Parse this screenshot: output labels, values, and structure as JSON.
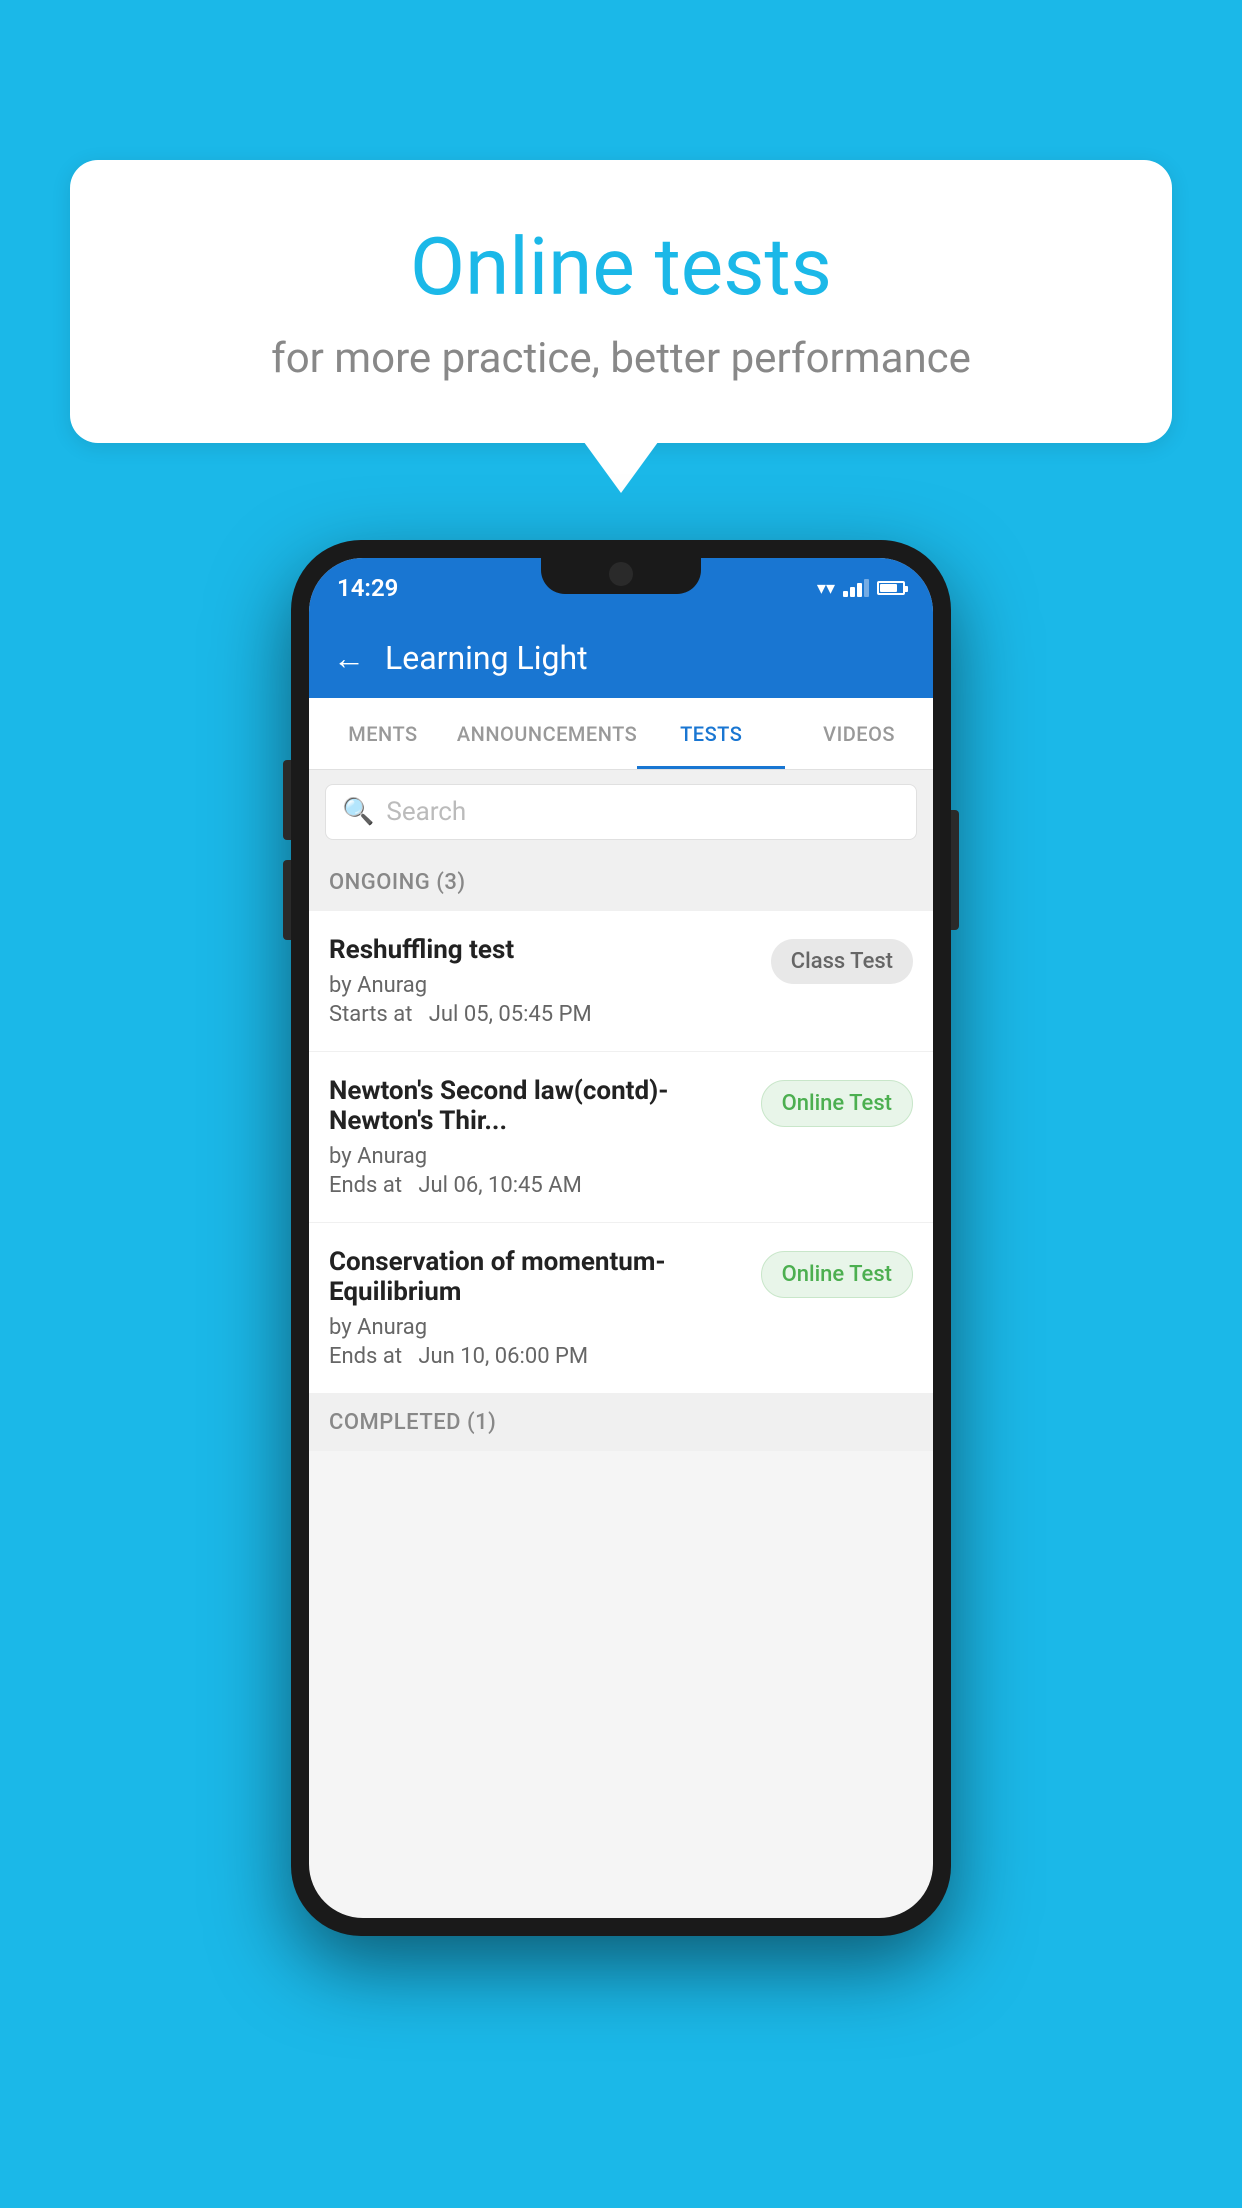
{
  "background": {
    "color": "#1BB8E8"
  },
  "speech_bubble": {
    "title": "Online tests",
    "subtitle": "for more practice, better performance"
  },
  "phone": {
    "status_bar": {
      "time": "14:29"
    },
    "app_header": {
      "title": "Learning Light",
      "back_label": "←"
    },
    "tabs": [
      {
        "label": "MENTS",
        "active": false
      },
      {
        "label": "ANNOUNCEMENTS",
        "active": false
      },
      {
        "label": "TESTS",
        "active": true
      },
      {
        "label": "VIDEOS",
        "active": false
      }
    ],
    "search": {
      "placeholder": "Search"
    },
    "ongoing_section": {
      "label": "ONGOING (3)"
    },
    "tests": [
      {
        "name": "Reshuffling test",
        "author": "by Anurag",
        "date_label": "Starts at",
        "date": "Jul 05, 05:45 PM",
        "badge": "Class Test",
        "badge_type": "class"
      },
      {
        "name": "Newton's Second law(contd)-Newton's Thir...",
        "author": "by Anurag",
        "date_label": "Ends at",
        "date": "Jul 06, 10:45 AM",
        "badge": "Online Test",
        "badge_type": "online"
      },
      {
        "name": "Conservation of momentum-Equilibrium",
        "author": "by Anurag",
        "date_label": "Ends at",
        "date": "Jun 10, 06:00 PM",
        "badge": "Online Test",
        "badge_type": "online"
      }
    ],
    "completed_section": {
      "label": "COMPLETED (1)"
    }
  }
}
